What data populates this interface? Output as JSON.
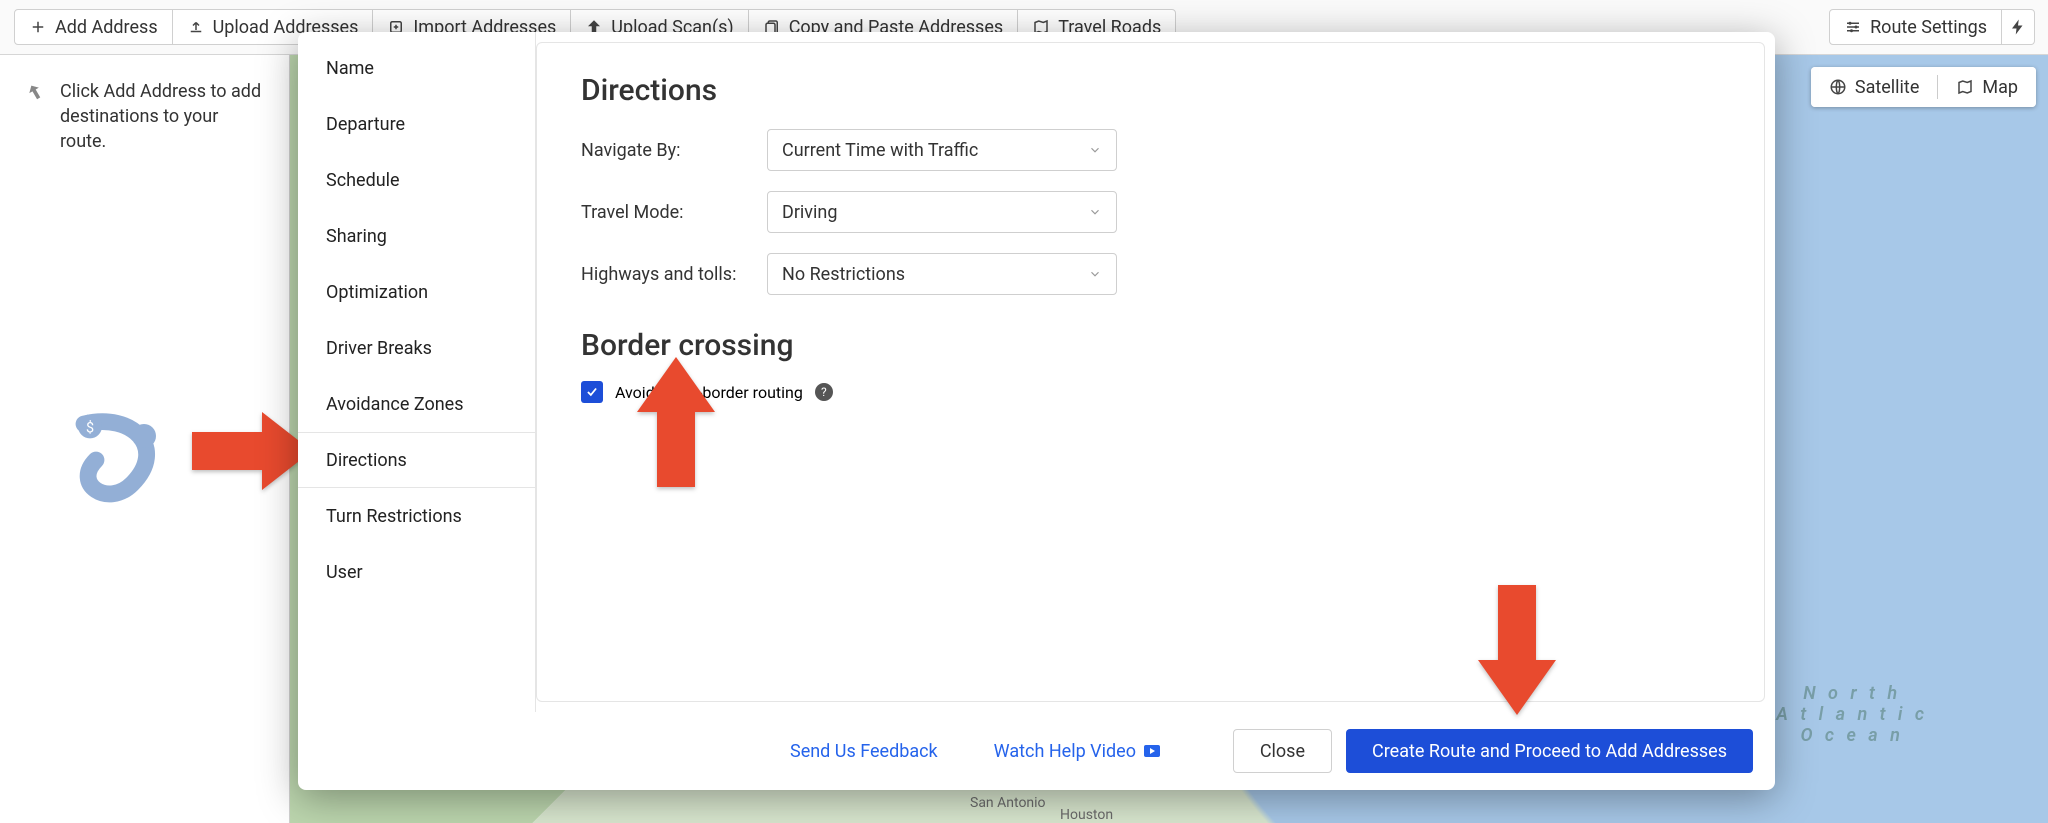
{
  "toolbar": {
    "add_address": "Add Address",
    "upload_addresses": "Upload Addresses",
    "import_addresses": "Import Addresses",
    "upload_scans": "Upload Scan(s)",
    "copy_paste": "Copy and Paste Addresses",
    "travel_roads": "Travel Roads",
    "route_settings": "Route Settings"
  },
  "hint": {
    "text": "Click Add Address to add destinations to your route."
  },
  "map": {
    "toggle": {
      "satellite": "Satellite",
      "map": "Map"
    },
    "ocean_label": "N o r t h\nA t l a n t i c\nO c e a n",
    "cities": {
      "san_antonio": "San Antonio",
      "houston": "Houston"
    }
  },
  "sidebar": {
    "items": [
      {
        "label": "Name"
      },
      {
        "label": "Departure"
      },
      {
        "label": "Schedule"
      },
      {
        "label": "Sharing"
      },
      {
        "label": "Optimization"
      },
      {
        "label": "Driver Breaks"
      },
      {
        "label": "Avoidance Zones"
      },
      {
        "label": "Directions"
      },
      {
        "label": "Turn Restrictions"
      },
      {
        "label": "User"
      }
    ],
    "active_index": 7
  },
  "panel": {
    "heading_directions": "Directions",
    "heading_border": "Border crossing",
    "navigate_by": {
      "label": "Navigate By:",
      "value": "Current Time with Traffic"
    },
    "travel_mode": {
      "label": "Travel Mode:",
      "value": "Driving"
    },
    "highways_tolls": {
      "label": "Highways and tolls:",
      "value": "No Restrictions"
    },
    "avoid_cross_border": {
      "label": "Avoid cross-border routing",
      "checked": true
    }
  },
  "footer": {
    "feedback": "Send Us Feedback",
    "watch_video": "Watch Help Video",
    "close": "Close",
    "create": "Create Route and Proceed to Add Addresses"
  }
}
